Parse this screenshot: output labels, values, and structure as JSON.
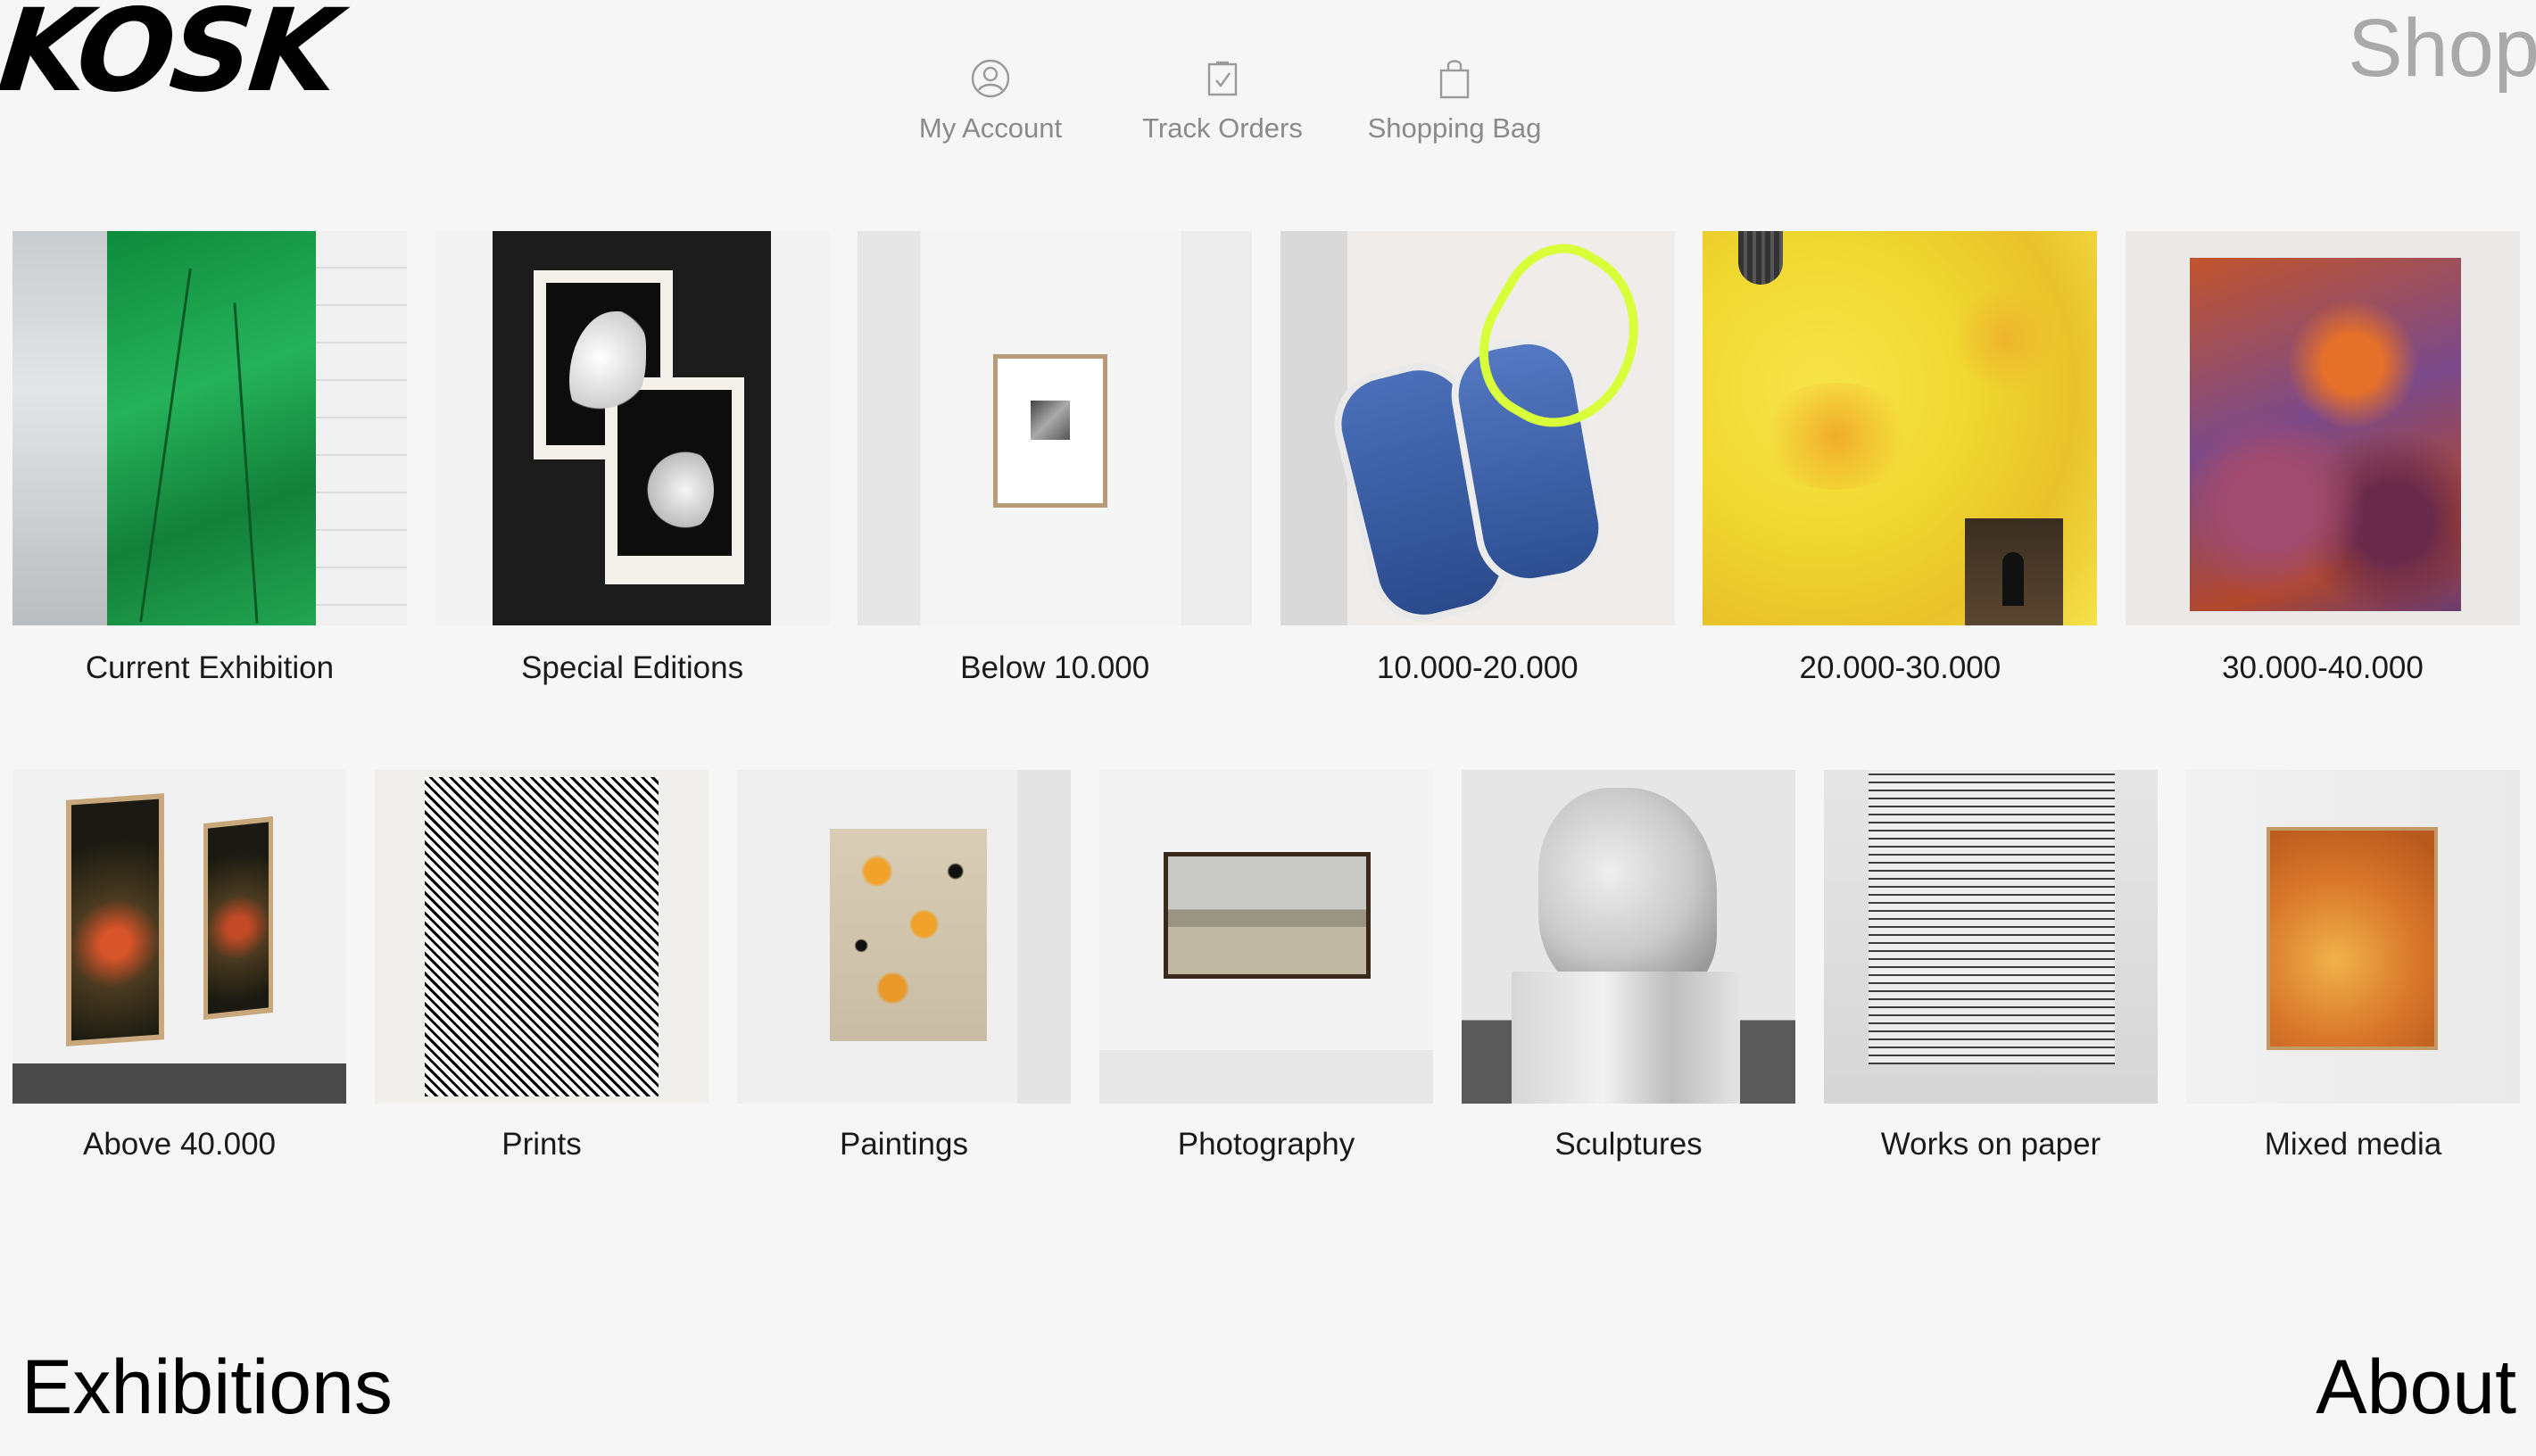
{
  "header": {
    "logo": "KÖSK",
    "nav": [
      {
        "label": "My Account",
        "icon": "account-icon"
      },
      {
        "label": "Track Orders",
        "icon": "track-orders-icon"
      },
      {
        "label": "Shopping Bag",
        "icon": "shopping-bag-icon"
      }
    ],
    "section_title": "Shop"
  },
  "categories_row1": [
    {
      "label": "Current Exhibition"
    },
    {
      "label": "Special Editions"
    },
    {
      "label": "Below 10.000"
    },
    {
      "label": "10.000-20.000"
    },
    {
      "label": "20.000-30.000"
    },
    {
      "label": "30.000-40.000"
    }
  ],
  "categories_row2": [
    {
      "label": "Above 40.000"
    },
    {
      "label": "Prints"
    },
    {
      "label": "Paintings"
    },
    {
      "label": "Photography"
    },
    {
      "label": "Sculptures"
    },
    {
      "label": "Works on paper"
    },
    {
      "label": "Mixed media"
    }
  ],
  "footer": {
    "left_link": "Exhibitions",
    "right_link": "About"
  }
}
